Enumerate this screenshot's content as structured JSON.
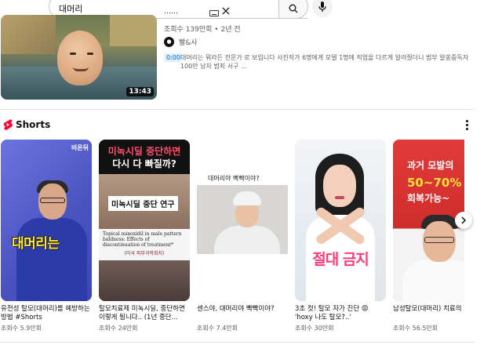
{
  "search": {
    "query": "대머리"
  },
  "video": {
    "duration": "13:43",
    "views_time": "조회수 139만회 • 2년 전",
    "channel_name": "빨&사",
    "chapter_timestamp": "0:00",
    "description": "대머리는 뭐라든 전문가 로 보입니다 사진작가 6명에게 모델 1명에 직업을 다르게 알려줬더니 범부 알쏭중독자 100만 남자 범죄 서구 ..."
  },
  "shorts": {
    "title": "Shorts",
    "cards": [
      {
        "title": "유전성 탈모(대머리)를 예방하는 방법 #Shorts",
        "views": "조회수 5.9만회",
        "overlay_text": "대머리는",
        "overlay_tag": "비온뒤"
      },
      {
        "title": "탈모치료제 미녹시딜, 중단하면 이렇게 됩니다.. (1년 중단...",
        "views": "조회수 24만회",
        "overlay_line1": "미녹시딜 중단하면",
        "overlay_line2": "다시 다 빠질까?",
        "overlay_study": "미녹시딜 중단 연구",
        "overlay_paper": "Topical minoxidil in male pattern baldness: Effects of discontinuation of treatment*",
        "overlay_source": "(미국 피부과학회지)"
      },
      {
        "title": "센스야, 대머리야 빡빡이야?",
        "views": "조회수 7.4만회",
        "overlay_label": "대머리야 빡빡이야?"
      },
      {
        "title": "3초 컷! 탈모 자가 진단 😡 'hoxy 나도 탈모?..'",
        "views": "조회수 30만회",
        "overlay_text": "절대 금지"
      },
      {
        "title": "남성탈모(대머리) 치료의 핵심 #shorts",
        "views": "조회수 56.5만회",
        "overlay_line1": "과거 모발의",
        "overlay_line2": "50~70%",
        "overlay_line3": "회복가능~"
      }
    ]
  },
  "colors": {
    "accent_red": "#ff0033",
    "link_blue": "#065fd4",
    "muted_text": "#606060"
  }
}
